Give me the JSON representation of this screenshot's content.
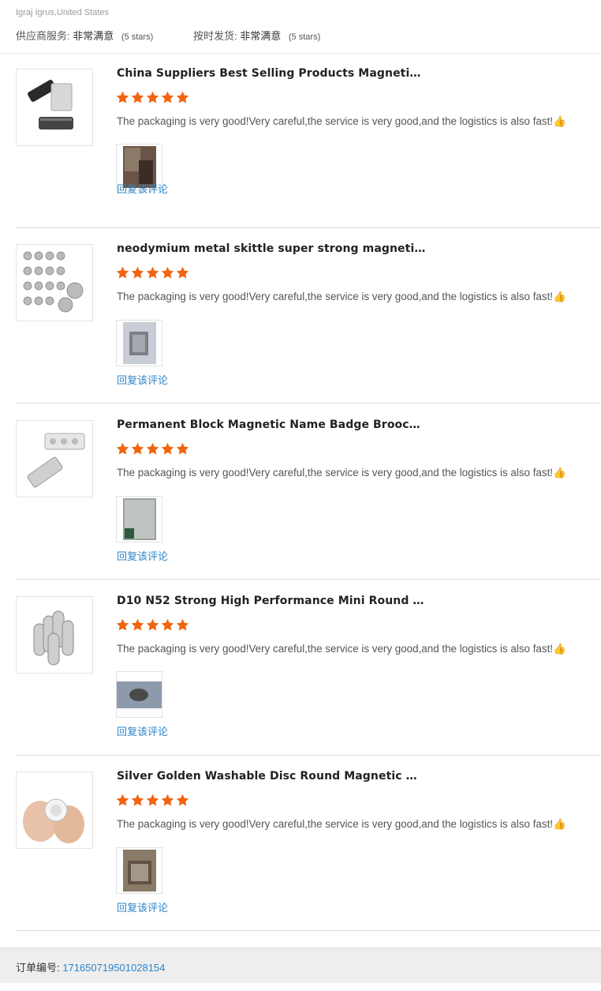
{
  "buyer": "Igraj Igrus,United States",
  "seller_ratings": [
    {
      "label": "供应商服务:",
      "value": "非常满意",
      "note": "(5 stars)"
    },
    {
      "label": "按时发货:",
      "value": "非常满意",
      "note": "(5 stars)"
    }
  ],
  "reviews": [
    {
      "product_title": "China Suppliers Best Selling Products Magneti…",
      "stars": 5,
      "comment": "The packaging is very good!Very careful,the service is very good,and the logistics is also fast!👍",
      "reply_label": "回复该评论",
      "thumb_icon": "magnetic-badge-image",
      "photo_icon": "customer-photo"
    },
    {
      "product_title": "neodymium metal skittle super strong magneti…",
      "stars": 5,
      "comment": "The packaging is very good!Very careful,the service is very good,and the logistics is also fast!👍",
      "reply_label": "回复该评论",
      "thumb_icon": "magnet-pins-image",
      "photo_icon": "customer-photo"
    },
    {
      "product_title": "Permanent Block Magnetic Name Badge Brooc…",
      "stars": 5,
      "comment": "The packaging is very good!Very careful,the service is very good,and the logistics is also fast!👍",
      "reply_label": "回复该评论",
      "thumb_icon": "name-badge-magnet-image",
      "photo_icon": "customer-photo"
    },
    {
      "product_title": "D10 N52 Strong High Performance Mini Round …",
      "stars": 5,
      "comment": "The packaging is very good!Very careful,the service is very good,and the logistics is also fast!👍",
      "reply_label": "回复该评论",
      "thumb_icon": "round-magnets-image",
      "photo_icon": "customer-photo"
    },
    {
      "product_title": "Silver Golden Washable Disc Round Magnetic …",
      "stars": 5,
      "comment": "The packaging is very good!Very careful,the service is very good,and the logistics is also fast!👍",
      "reply_label": "回复该评论",
      "thumb_icon": "disc-magnet-hand-image",
      "photo_icon": "customer-photo"
    }
  ],
  "order": {
    "label": "订单编号:",
    "number": "171650719501028154"
  },
  "colors": {
    "star": "#f2640f",
    "link": "#2a86c9",
    "footer_bg": "#eeeeee"
  }
}
